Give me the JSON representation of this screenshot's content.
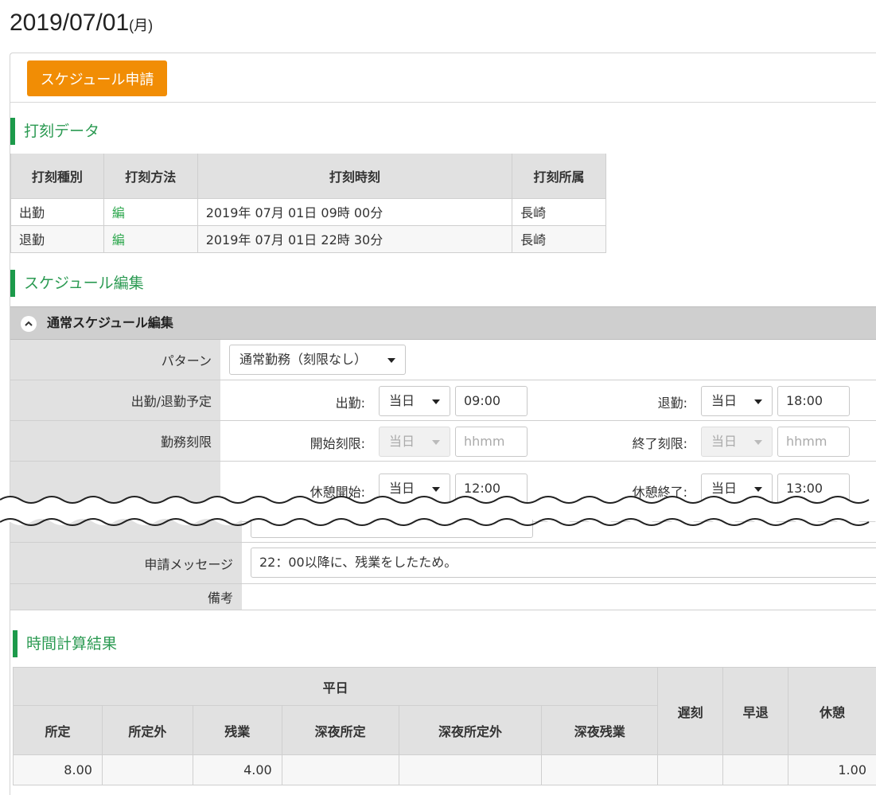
{
  "page": {
    "date": "2019/07/01",
    "day_of_week": "(月)"
  },
  "toolbar": {
    "apply_label": "スケジュール申請"
  },
  "stamp_section": {
    "title": "打刻データ",
    "headers": [
      "打刻種別",
      "打刻方法",
      "打刻時刻",
      "打刻所属"
    ],
    "rows": [
      {
        "type": "出勤",
        "method": "編",
        "time": "2019年 07月 01日 09時 00分",
        "affiliation": "長崎"
      },
      {
        "type": "退勤",
        "method": "編",
        "time": "2019年 07月 01日 22時 30分",
        "affiliation": "長崎"
      }
    ]
  },
  "schedule_section": {
    "title": "スケジュール編集",
    "panel_title": "通常スケジュール編集",
    "pattern": {
      "label": "パターン",
      "value": "通常勤務（刻限なし）"
    },
    "attendance": {
      "label": "出勤/退勤予定",
      "start_label": "出勤:",
      "start_day": "当日",
      "start_time": "09:00",
      "end_label": "退勤:",
      "end_day": "当日",
      "end_time": "18:00"
    },
    "limits": {
      "label": "勤務刻限",
      "start_label": "開始刻限:",
      "start_day": "当日",
      "start_placeholder": "hhmm",
      "end_label": "終了刻限:",
      "end_day": "当日",
      "end_placeholder": "hhmm"
    },
    "break": {
      "start_label": "休憩開始:",
      "start_day": "当日",
      "start_time": "12:00",
      "end_label": "休憩終了:",
      "end_day": "当日",
      "end_time": "13:00"
    },
    "message": {
      "label": "申請メッセージ",
      "value": "22：00以降に、残業をしたため。"
    },
    "remarks": {
      "label": "備考"
    }
  },
  "calc_section": {
    "title": "時間計算結果",
    "weekday_header": "平日",
    "sub_headers": [
      "所定",
      "所定外",
      "残業",
      "深夜所定",
      "深夜所定外",
      "深夜残業"
    ],
    "side_headers": [
      "遅刻",
      "早退",
      "休憩"
    ],
    "values": [
      "8.00",
      "",
      "4.00",
      "",
      "",
      "",
      "",
      "",
      "1.00"
    ]
  },
  "colors": {
    "accent_button": "#f18d05",
    "section_green": "#1c9a4a"
  }
}
